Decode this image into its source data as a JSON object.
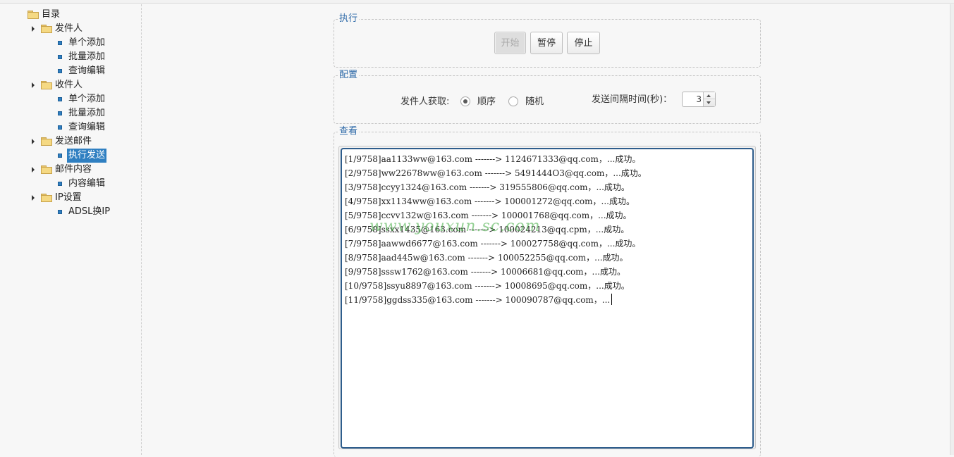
{
  "tree": {
    "root": "目录",
    "groups": [
      {
        "label": "发件人",
        "children": [
          "单个添加",
          "批量添加",
          "查询编辑"
        ]
      },
      {
        "label": "收件人",
        "children": [
          "单个添加",
          "批量添加",
          "查询编辑"
        ]
      },
      {
        "label": "发送邮件",
        "children": [
          "执行发送"
        ]
      },
      {
        "label": "邮件内容",
        "children": [
          "内容编辑"
        ]
      },
      {
        "label": "IP设置",
        "children": [
          "ADSL换IP"
        ]
      }
    ],
    "selected": "执行发送"
  },
  "execute": {
    "legend": "执行",
    "start_label": "开始",
    "pause_label": "暂停",
    "stop_label": "停止"
  },
  "config": {
    "legend": "配置",
    "sender_fetch_label": "发件人获取:",
    "option_sequential": "顺序",
    "option_random": "随机",
    "selected_option": "顺序",
    "interval_label": "发送间隔时间(秒)：",
    "interval_value": "3"
  },
  "view": {
    "legend": "查看",
    "watermark": "www.youxun.sc.com",
    "log_lines": [
      "[1/9758]aa1133ww@163.com -------> 1124671333@qq.com，...成功。",
      "[2/9758]ww22678ww@163.com -------> 5491444O3@qq.com，...成功。",
      "[3/9758]ccyy1324@163.com -------> 319555806@qq.com，...成功。",
      "[4/9758]xx1134ww@163.com -------> 100001272@qq.com，...成功。",
      "[5/9758]ccvv132w@163.com -------> 100001768@qq.com，...成功。",
      "[6/9758]ssxx1435@163.com -------> 100024213@qq.cpm，...成功。",
      "[7/9758]aawwd6677@163.com -------> 100027758@qq.com，...成功。",
      "[8/9758]aad445w@163.com -------> 100052255@qq.com，...成功。",
      "[9/9758]sssw1762@163.com -------> 10006681@qq.com，...成功。",
      "[10/9758]ssyu8897@163.com -------> 10008695@qq.com，...成功。",
      "[11/9758]ggdss335@163.com -------> 100090787@qq.com，..."
    ]
  }
}
